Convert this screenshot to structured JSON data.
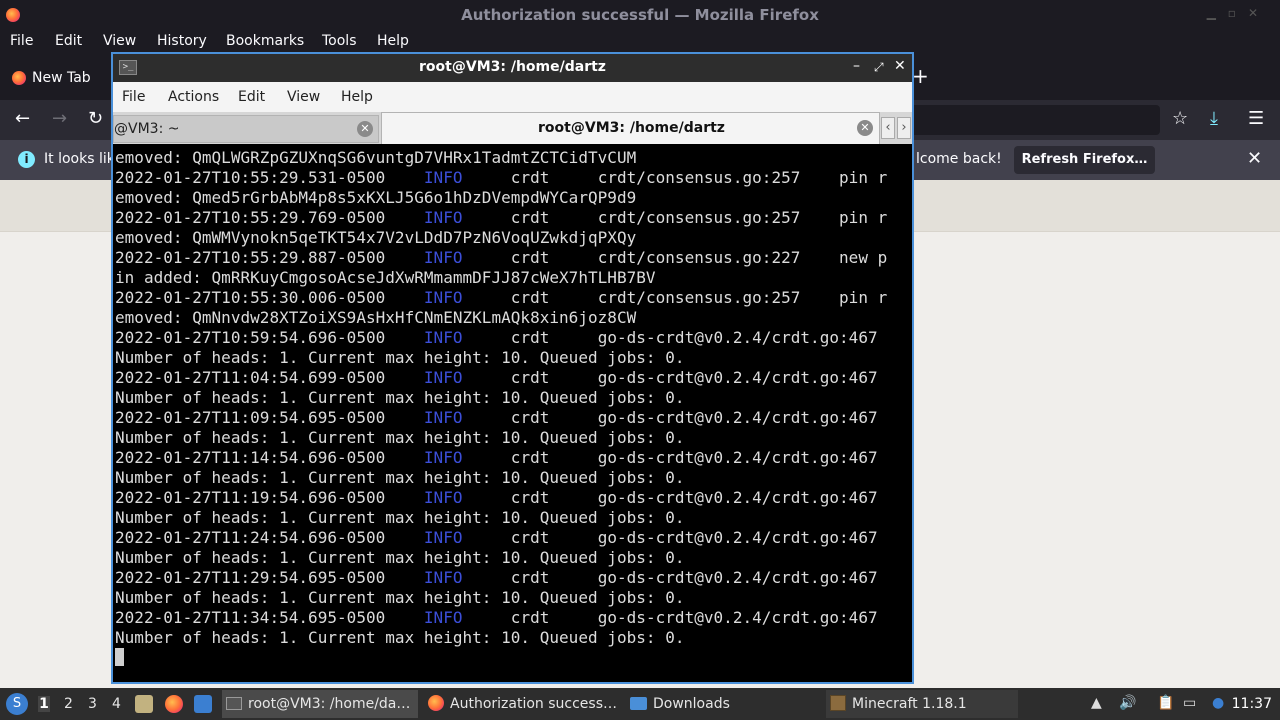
{
  "firefox": {
    "window_title": "Authorization successful — Mozilla Firefox",
    "menu": [
      "File",
      "Edit",
      "View",
      "History",
      "Bookmarks",
      "Tools",
      "Help"
    ],
    "tab_label": "New Tab",
    "new_tab_glyph": "+",
    "notice_text_left": "It looks lik",
    "notice_text_right": "lcome back!",
    "refresh_button": "Refresh Firefox…",
    "notice_close": "✕"
  },
  "terminal": {
    "window_title": "root@VM3: /home/dartz",
    "menu": [
      "File",
      "Actions",
      "Edit",
      "View",
      "Help"
    ],
    "tabs": [
      {
        "label": "@VM3: ~"
      },
      {
        "label": "root@VM3: /home/dartz"
      }
    ],
    "lines": [
      {
        "text": "emoved: QmQLWGRZpGZUXnqSG6vuntgD7VHRx1TadmtZCTCidTvCUM"
      },
      {
        "ts": "2022-01-27T10:55:29.531-0500",
        "level": "INFO",
        "logger": "crdt",
        "caller": "crdt/consensus.go:257",
        "msg": "pin r"
      },
      {
        "text": "emoved: Qmed5rGrbAbM4p8s5xKXLJ5G6o1hDzDVempdWYCarQP9d9"
      },
      {
        "ts": "2022-01-27T10:55:29.769-0500",
        "level": "INFO",
        "logger": "crdt",
        "caller": "crdt/consensus.go:257",
        "msg": "pin r"
      },
      {
        "text": "emoved: QmWMVynokn5qeTKT54x7V2vLDdD7PzN6VoqUZwkdjqPXQy"
      },
      {
        "ts": "2022-01-27T10:55:29.887-0500",
        "level": "INFO",
        "logger": "crdt",
        "caller": "crdt/consensus.go:227",
        "msg": "new p"
      },
      {
        "text": "in added: QmRRKuyCmgosoAcseJdXwRMmammDFJJ87cWeX7hTLHB7BV"
      },
      {
        "ts": "2022-01-27T10:55:30.006-0500",
        "level": "INFO",
        "logger": "crdt",
        "caller": "crdt/consensus.go:257",
        "msg": "pin r"
      },
      {
        "text": "emoved: QmNnvdw28XTZoiXS9AsHxHfCNmENZKLmAQk8xin6joz8CW"
      },
      {
        "ts": "2022-01-27T10:59:54.696-0500",
        "level": "INFO",
        "logger": "crdt",
        "caller": "go-ds-crdt@v0.2.4/crdt.go:467",
        "msg": ""
      },
      {
        "text": "Number of heads: 1. Current max height: 10. Queued jobs: 0."
      },
      {
        "ts": "2022-01-27T11:04:54.699-0500",
        "level": "INFO",
        "logger": "crdt",
        "caller": "go-ds-crdt@v0.2.4/crdt.go:467",
        "msg": ""
      },
      {
        "text": "Number of heads: 1. Current max height: 10. Queued jobs: 0."
      },
      {
        "ts": "2022-01-27T11:09:54.695-0500",
        "level": "INFO",
        "logger": "crdt",
        "caller": "go-ds-crdt@v0.2.4/crdt.go:467",
        "msg": ""
      },
      {
        "text": "Number of heads: 1. Current max height: 10. Queued jobs: 0."
      },
      {
        "ts": "2022-01-27T11:14:54.696-0500",
        "level": "INFO",
        "logger": "crdt",
        "caller": "go-ds-crdt@v0.2.4/crdt.go:467",
        "msg": ""
      },
      {
        "text": "Number of heads: 1. Current max height: 10. Queued jobs: 0."
      },
      {
        "ts": "2022-01-27T11:19:54.696-0500",
        "level": "INFO",
        "logger": "crdt",
        "caller": "go-ds-crdt@v0.2.4/crdt.go:467",
        "msg": ""
      },
      {
        "text": "Number of heads: 1. Current max height: 10. Queued jobs: 0."
      },
      {
        "ts": "2022-01-27T11:24:54.696-0500",
        "level": "INFO",
        "logger": "crdt",
        "caller": "go-ds-crdt@v0.2.4/crdt.go:467",
        "msg": ""
      },
      {
        "text": "Number of heads: 1. Current max height: 10. Queued jobs: 0."
      },
      {
        "ts": "2022-01-27T11:29:54.695-0500",
        "level": "INFO",
        "logger": "crdt",
        "caller": "go-ds-crdt@v0.2.4/crdt.go:467",
        "msg": ""
      },
      {
        "text": "Number of heads: 1. Current max height: 10. Queued jobs: 0."
      },
      {
        "ts": "2022-01-27T11:34:54.695-0500",
        "level": "INFO",
        "logger": "crdt",
        "caller": "go-ds-crdt@v0.2.4/crdt.go:467",
        "msg": ""
      },
      {
        "text": "Number of heads: 1. Current max height: 10. Queued jobs: 0."
      }
    ],
    "colors": {
      "background": "#000000",
      "text": "#dcdcdc",
      "info_level": "#3b4ed8",
      "window_border": "#4a90d9"
    }
  },
  "taskbar": {
    "workspaces": [
      "1",
      "2",
      "3",
      "4"
    ],
    "tasks": [
      {
        "label": "root@VM3: /home/da…",
        "icon": "terminal-icon"
      },
      {
        "label": "Authorization success…",
        "icon": "firefox-icon"
      },
      {
        "label": "Downloads",
        "icon": "folder-icon"
      },
      {
        "label": "Minecraft 1.18.1",
        "icon": "minecraft-icon"
      }
    ],
    "clock": "11:37"
  }
}
